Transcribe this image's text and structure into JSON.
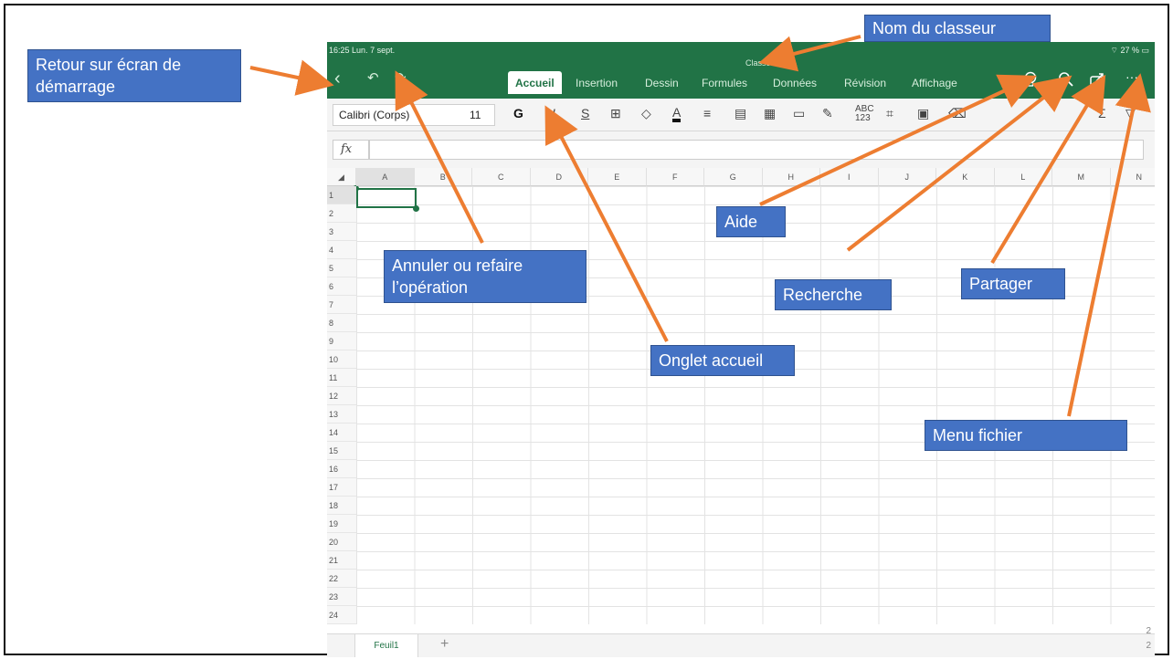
{
  "ipad": {
    "status_time": "16:25",
    "status_date": "Lun. 7 sept.",
    "status_battery": "27 %",
    "workbook_name": "Classeur",
    "tabs": [
      "Accueil",
      "Insertion",
      "Dessin",
      "Formules",
      "Données",
      "Révision",
      "Affichage"
    ],
    "font_name": "Calibri (Corps)",
    "font_size": "11",
    "bold_label": "G",
    "italic_label": "I",
    "strike_label": "S",
    "fx_label": "fx",
    "columns": [
      "A",
      "B",
      "C",
      "D",
      "E",
      "F",
      "G",
      "H",
      "I",
      "J",
      "K",
      "L",
      "M",
      "N"
    ],
    "rows": [
      "1",
      "2",
      "3",
      "4",
      "5",
      "6",
      "7",
      "8",
      "9",
      "10",
      "11",
      "12",
      "13",
      "14",
      "15",
      "16",
      "17",
      "18",
      "19",
      "20",
      "21",
      "22",
      "23",
      "24"
    ],
    "sheet_name": "Feuil1",
    "add_sheet": "+",
    "page_num_top": "2",
    "page_num_bottom": "2"
  },
  "callouts": {
    "home": "Retour sur écran de démarrage",
    "workbook": "Nom du classeur",
    "undo": "Annuler ou refaire l’opération",
    "tab": "Onglet accueil",
    "help": "Aide",
    "search": "Recherche",
    "share": "Partager",
    "file_menu": "Menu fichier"
  },
  "colors": {
    "excel_green": "#217346",
    "callout_blue": "#4472c4",
    "arrow_orange": "#ed7d31"
  }
}
